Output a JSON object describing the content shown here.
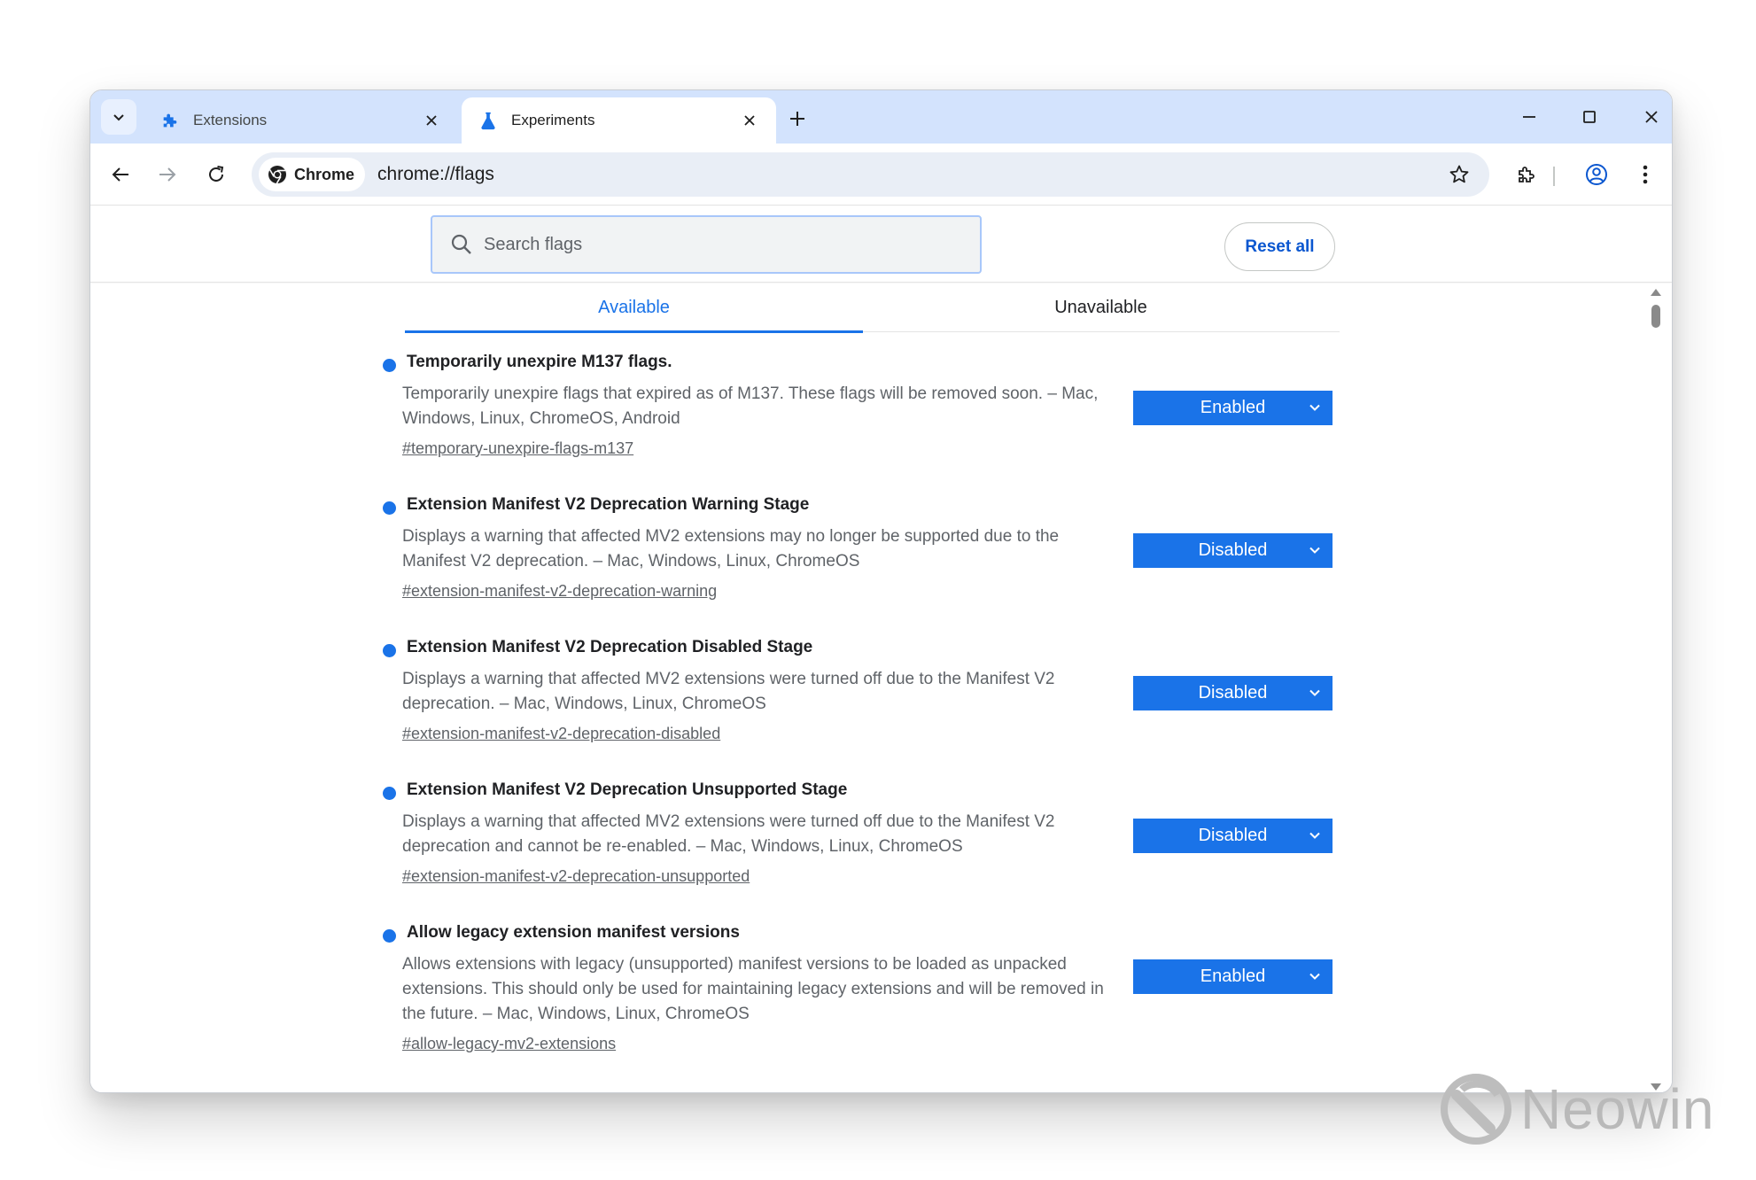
{
  "tabs": [
    {
      "title": "Extensions",
      "icon": "puzzle-icon"
    },
    {
      "title": "Experiments",
      "icon": "flask-icon"
    }
  ],
  "omnibox": {
    "chip_label": "Chrome",
    "url": "chrome://flags"
  },
  "header": {
    "search_placeholder": "Search flags",
    "reset_label": "Reset all"
  },
  "flag_tabs": {
    "available": "Available",
    "unavailable": "Unavailable"
  },
  "flags": [
    {
      "name": "Temporarily unexpire M137 flags.",
      "description": "Temporarily unexpire flags that expired as of M137. These flags will be removed soon. – Mac, Windows, Linux, ChromeOS, Android",
      "link": "#temporary-unexpire-flags-m137",
      "value": "Enabled"
    },
    {
      "name": "Extension Manifest V2 Deprecation Warning Stage",
      "description": "Displays a warning that affected MV2 extensions may no longer be supported due to the Manifest V2 deprecation. – Mac, Windows, Linux, ChromeOS",
      "link": "#extension-manifest-v2-deprecation-warning",
      "value": "Disabled"
    },
    {
      "name": "Extension Manifest V2 Deprecation Disabled Stage",
      "description": "Displays a warning that affected MV2 extensions were turned off due to the Manifest V2 deprecation. – Mac, Windows, Linux, ChromeOS",
      "link": "#extension-manifest-v2-deprecation-disabled",
      "value": "Disabled"
    },
    {
      "name": "Extension Manifest V2 Deprecation Unsupported Stage",
      "description": "Displays a warning that affected MV2 extensions were turned off due to the Manifest V2 deprecation and cannot be re-enabled. – Mac, Windows, Linux, ChromeOS",
      "link": "#extension-manifest-v2-deprecation-unsupported",
      "value": "Disabled"
    },
    {
      "name": "Allow legacy extension manifest versions",
      "description": "Allows extensions with legacy (unsupported) manifest versions to be loaded as unpacked extensions. This should only be used for maintaining legacy extensions and will be removed in the future. – Mac, Windows, Linux, ChromeOS",
      "link": "#allow-legacy-mv2-extensions",
      "value": "Enabled"
    }
  ],
  "watermark": {
    "text": "Neowin"
  },
  "colors": {
    "accent": "#1a73e8",
    "tabstrip": "#d3e3fd",
    "omnibox": "#e9eef6"
  }
}
